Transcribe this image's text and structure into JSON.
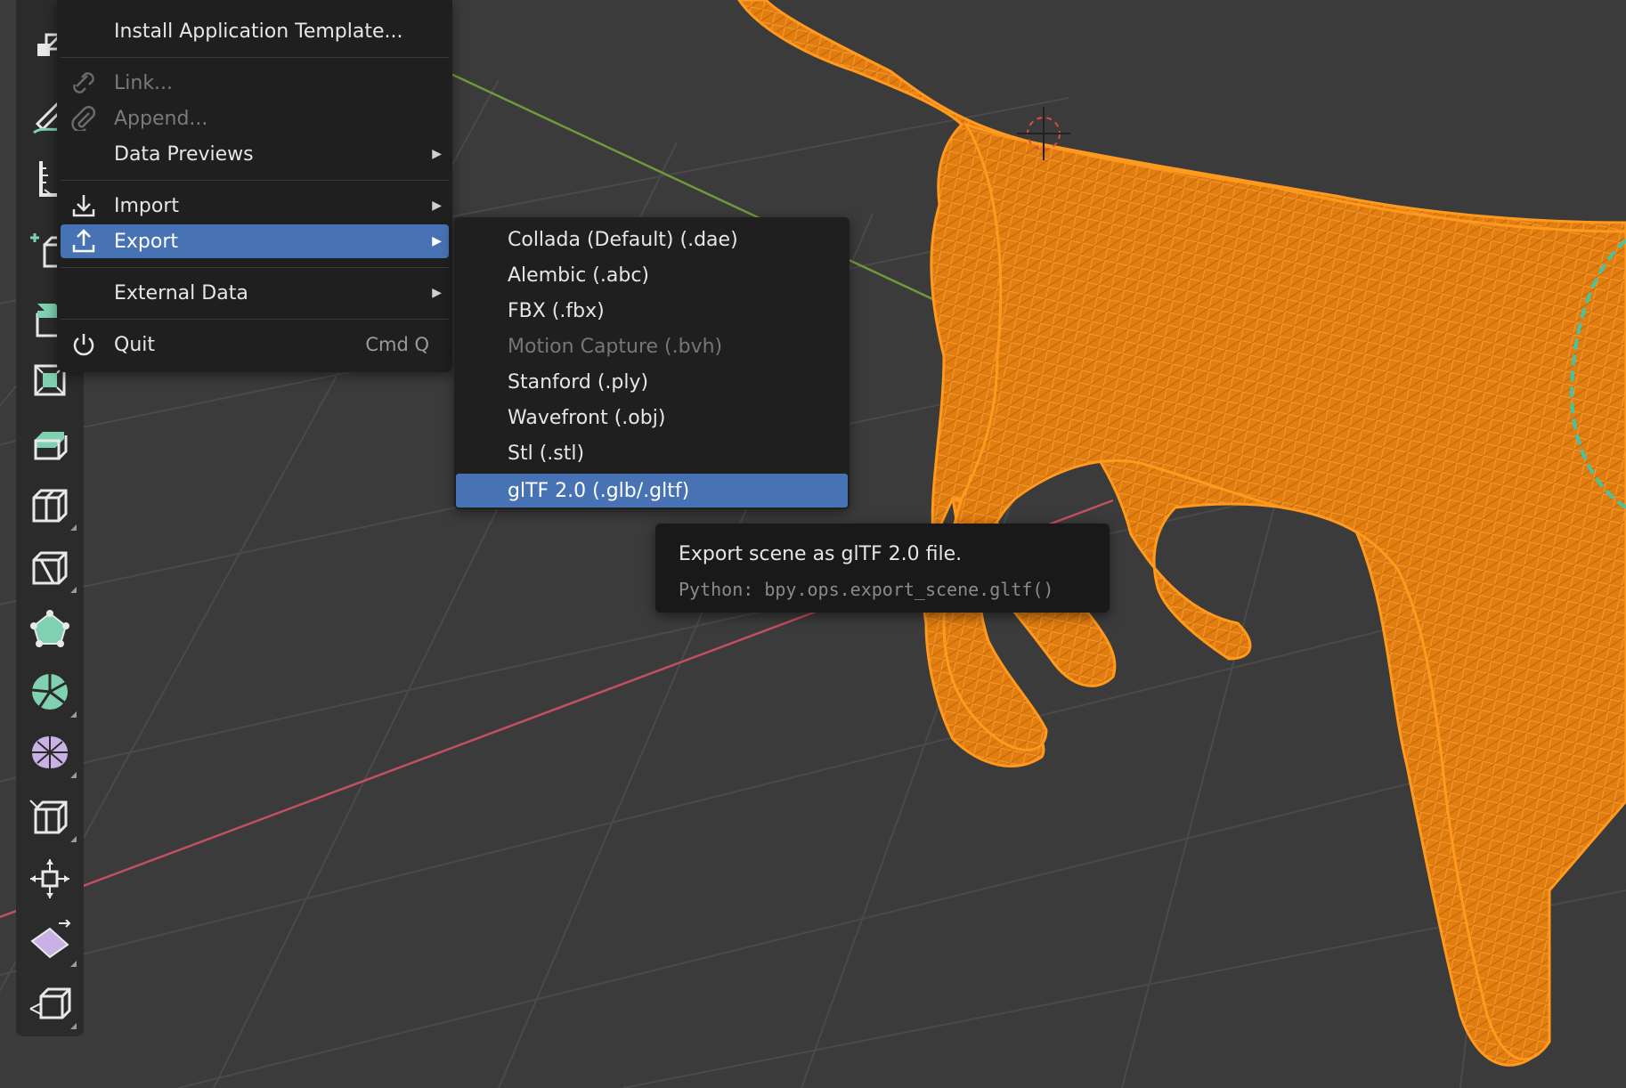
{
  "file_menu": {
    "items": [
      {
        "label": "Install Application Template...",
        "state": "normal",
        "icon": "none"
      },
      {
        "label": "Link...",
        "state": "disabled",
        "icon": "link-icon"
      },
      {
        "label": "Append...",
        "state": "disabled",
        "icon": "paperclip-icon"
      },
      {
        "label": "Data Previews",
        "state": "normal",
        "icon": "none",
        "submenu": true
      },
      {
        "label": "Import",
        "state": "normal",
        "icon": "import-icon",
        "submenu": true
      },
      {
        "label": "Export",
        "state": "active",
        "icon": "export-icon",
        "submenu": true
      },
      {
        "label": "External Data",
        "state": "normal",
        "icon": "none",
        "submenu": true
      },
      {
        "label": "Quit",
        "state": "normal",
        "icon": "power-icon",
        "shortcut": "Cmd Q"
      }
    ]
  },
  "export_submenu": {
    "items": [
      {
        "label": "Collada (Default) (.dae)",
        "state": "normal"
      },
      {
        "label": "Alembic (.abc)",
        "state": "normal"
      },
      {
        "label": "FBX (.fbx)",
        "state": "normal"
      },
      {
        "label": "Motion Capture (.bvh)",
        "state": "disabled"
      },
      {
        "label": "Stanford (.ply)",
        "state": "normal"
      },
      {
        "label": "Wavefront (.obj)",
        "state": "normal"
      },
      {
        "label": "Stl (.stl)",
        "state": "normal"
      },
      {
        "label": "glTF 2.0 (.glb/.gltf)",
        "state": "active"
      }
    ]
  },
  "tooltip": {
    "description": "Export scene as glTF 2.0 file.",
    "python": "Python: bpy.ops.export_scene.gltf()"
  },
  "toolbar": {
    "tools": [
      "resize-icon",
      "annotate-icon",
      "measure-icon",
      "add-cube-icon",
      "extrude-region-icon",
      "inset-faces-icon",
      "bevel-icon",
      "loop-cut-icon",
      "knife-icon",
      "poly-build-icon",
      "spin-icon",
      "smooth-icon",
      "edge-slide-icon",
      "shrink-fatten-icon",
      "shear-icon",
      "rip-region-icon"
    ]
  },
  "colors": {
    "viewport_bg": "#3b3b3b",
    "grid_line": "#4a4a4a",
    "x_axis": "#c4505f",
    "y_axis": "#6f9a3a",
    "mesh_wire": "#f58a0b",
    "selection": "#4772b3",
    "menu_bg": "#1f1f1f"
  }
}
